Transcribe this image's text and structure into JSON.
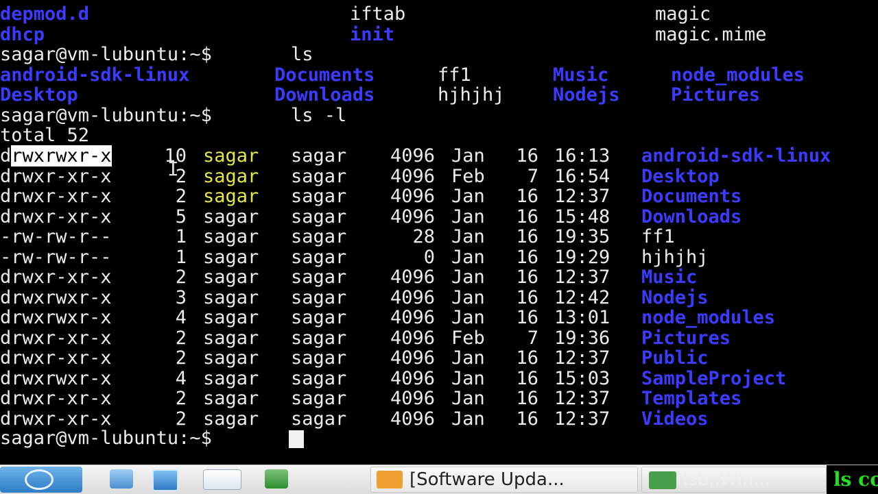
{
  "terminal": {
    "top_row_0": [
      "depmod.d",
      "iftab",
      "magic"
    ],
    "top_row_1": [
      "dhcp",
      "init",
      "magic.mime"
    ],
    "prompt": "sagar@vm-lubuntu:~$",
    "cmd_ls": "ls",
    "ls_row_0": [
      "android-sdk-linux",
      "Documents",
      "ff1",
      "Music",
      "node_modules"
    ],
    "ls_row_1": [
      "Desktop",
      "Downloads",
      "hjhjhj",
      "Nodejs",
      "Pictures"
    ],
    "cmd_lsl": "ls -l",
    "total": "total 52",
    "entries": [
      {
        "perm_first": "d",
        "perm_rest": "rwxrwxr-x",
        "links": "10",
        "owner": "sagar",
        "group": "sagar",
        "size": "4096",
        "month": "Jan",
        "day": "16",
        "time": "16:13",
        "name": "android-sdk-linux",
        "is_dir": true
      },
      {
        "perm_first": "d",
        "perm_rest": "rwxr-xr-x",
        "links": "2",
        "owner": "sagar",
        "group": "sagar",
        "size": "4096",
        "month": "Feb",
        "day": "7",
        "time": "16:54",
        "name": "Desktop",
        "is_dir": true
      },
      {
        "perm_first": "d",
        "perm_rest": "rwxr-xr-x",
        "links": "2",
        "owner": "sagar",
        "group": "sagar",
        "size": "4096",
        "month": "Jan",
        "day": "16",
        "time": "12:37",
        "name": "Documents",
        "is_dir": true
      },
      {
        "perm_first": "d",
        "perm_rest": "rwxr-xr-x",
        "links": "5",
        "owner": "sagar",
        "group": "sagar",
        "size": "4096",
        "month": "Jan",
        "day": "16",
        "time": "15:48",
        "name": "Downloads",
        "is_dir": true
      },
      {
        "perm_first": "-",
        "perm_rest": "rw-rw-r--",
        "links": "1",
        "owner": "sagar",
        "group": "sagar",
        "size": "28",
        "month": "Jan",
        "day": "16",
        "time": "19:35",
        "name": "ff1",
        "is_dir": false
      },
      {
        "perm_first": "-",
        "perm_rest": "rw-rw-r--",
        "links": "1",
        "owner": "sagar",
        "group": "sagar",
        "size": "0",
        "month": "Jan",
        "day": "16",
        "time": "19:29",
        "name": "hjhjhj",
        "is_dir": false
      },
      {
        "perm_first": "d",
        "perm_rest": "rwxr-xr-x",
        "links": "2",
        "owner": "sagar",
        "group": "sagar",
        "size": "4096",
        "month": "Jan",
        "day": "16",
        "time": "12:37",
        "name": "Music",
        "is_dir": true
      },
      {
        "perm_first": "d",
        "perm_rest": "rwxrwxr-x",
        "links": "3",
        "owner": "sagar",
        "group": "sagar",
        "size": "4096",
        "month": "Jan",
        "day": "16",
        "time": "12:42",
        "name": "Nodejs",
        "is_dir": true
      },
      {
        "perm_first": "d",
        "perm_rest": "rwxrwxr-x",
        "links": "4",
        "owner": "sagar",
        "group": "sagar",
        "size": "4096",
        "month": "Jan",
        "day": "16",
        "time": "13:01",
        "name": "node_modules",
        "is_dir": true
      },
      {
        "perm_first": "d",
        "perm_rest": "rwxr-xr-x",
        "links": "2",
        "owner": "sagar",
        "group": "sagar",
        "size": "4096",
        "month": "Feb",
        "day": "7",
        "time": "19:36",
        "name": "Pictures",
        "is_dir": true
      },
      {
        "perm_first": "d",
        "perm_rest": "rwxr-xr-x",
        "links": "2",
        "owner": "sagar",
        "group": "sagar",
        "size": "4096",
        "month": "Jan",
        "day": "16",
        "time": "12:37",
        "name": "Public",
        "is_dir": true
      },
      {
        "perm_first": "d",
        "perm_rest": "rwxrwxr-x",
        "links": "4",
        "owner": "sagar",
        "group": "sagar",
        "size": "4096",
        "month": "Jan",
        "day": "16",
        "time": "15:03",
        "name": "SampleProject",
        "is_dir": true
      },
      {
        "perm_first": "d",
        "perm_rest": "rwxr-xr-x",
        "links": "2",
        "owner": "sagar",
        "group": "sagar",
        "size": "4096",
        "month": "Jan",
        "day": "16",
        "time": "12:37",
        "name": "Templates",
        "is_dir": true
      },
      {
        "perm_first": "d",
        "perm_rest": "rwxr-xr-x",
        "links": "2",
        "owner": "sagar",
        "group": "sagar",
        "size": "4096",
        "month": "Jan",
        "day": "16",
        "time": "12:37",
        "name": "Videos",
        "is_dir": true
      }
    ]
  },
  "taskbar": {
    "software_update_label": "[Software Upda...",
    "terminal_task_label": "lsb..Win...",
    "overlay_text": "ls co"
  },
  "colors": {
    "background": "#000000",
    "directory": "#3b3bff",
    "text": "#ececec",
    "owner_highlight": "#e6e64a"
  },
  "icons": [
    "start-menu-icon",
    "file-manager-icon",
    "control-panel-icon",
    "browser-icon",
    "terminal-icon",
    "software-update-icon"
  ]
}
